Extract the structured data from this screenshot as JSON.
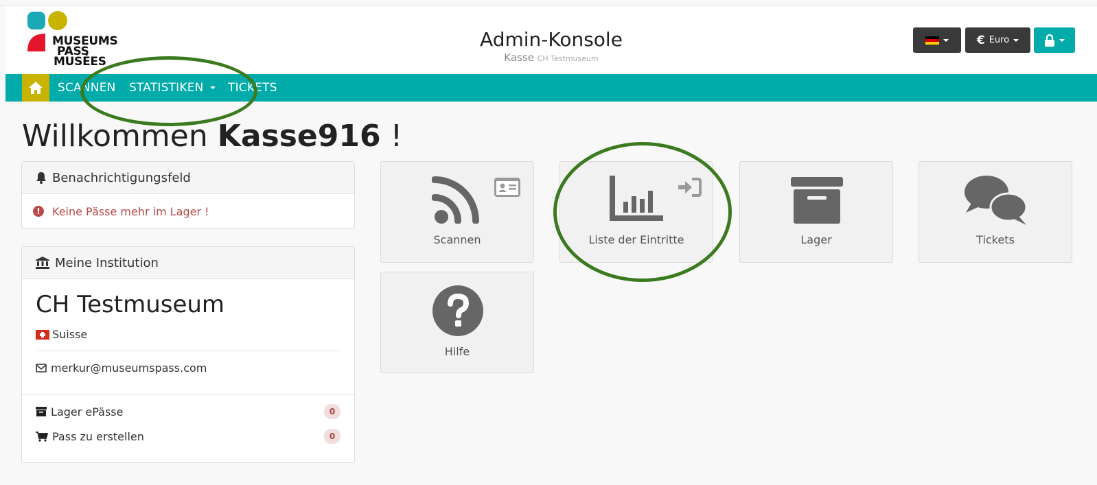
{
  "header": {
    "logo_lines": [
      "MUSEUMS",
      "PASS",
      "MUSÉES"
    ],
    "title": "Admin-Konsole",
    "subtitle_main": "Kasse",
    "subtitle_small": "CH Testmuseum",
    "currency_label": "Euro",
    "currency_symbol": "€"
  },
  "nav": {
    "items": [
      {
        "label": "SCANNEN"
      },
      {
        "label": "STATISTIKEN"
      },
      {
        "label": "TICKETS"
      }
    ]
  },
  "welcome": {
    "prefix": "Willkommen",
    "user": "Kasse916",
    "suffix": "!"
  },
  "notifications": {
    "title": "Benachrichtigungsfeld",
    "alert": "Keine Pässe mehr im Lager !"
  },
  "institution": {
    "title": "Meine Institution",
    "name": "CH Testmuseum",
    "country": "Suisse",
    "email": "merkur@museumspass.com",
    "stock_label": "Lager ePässe",
    "stock_count": "0",
    "create_label": "Pass zu erstellen",
    "create_count": "0"
  },
  "tiles": [
    {
      "label": "Scannen",
      "icon": "rss-icon"
    },
    {
      "label": "Liste der Eintritte",
      "icon": "bar-chart-icon"
    },
    {
      "label": "Lager",
      "icon": "archive-icon"
    },
    {
      "label": "Tickets",
      "icon": "comments-icon"
    },
    {
      "label": "Hilfe",
      "icon": "question-icon"
    }
  ],
  "colors": {
    "brand_teal": "#00aba9",
    "home_yellow": "#c8b400",
    "annotation_green": "#3b7a1e",
    "alert_red": "#b94a48"
  }
}
